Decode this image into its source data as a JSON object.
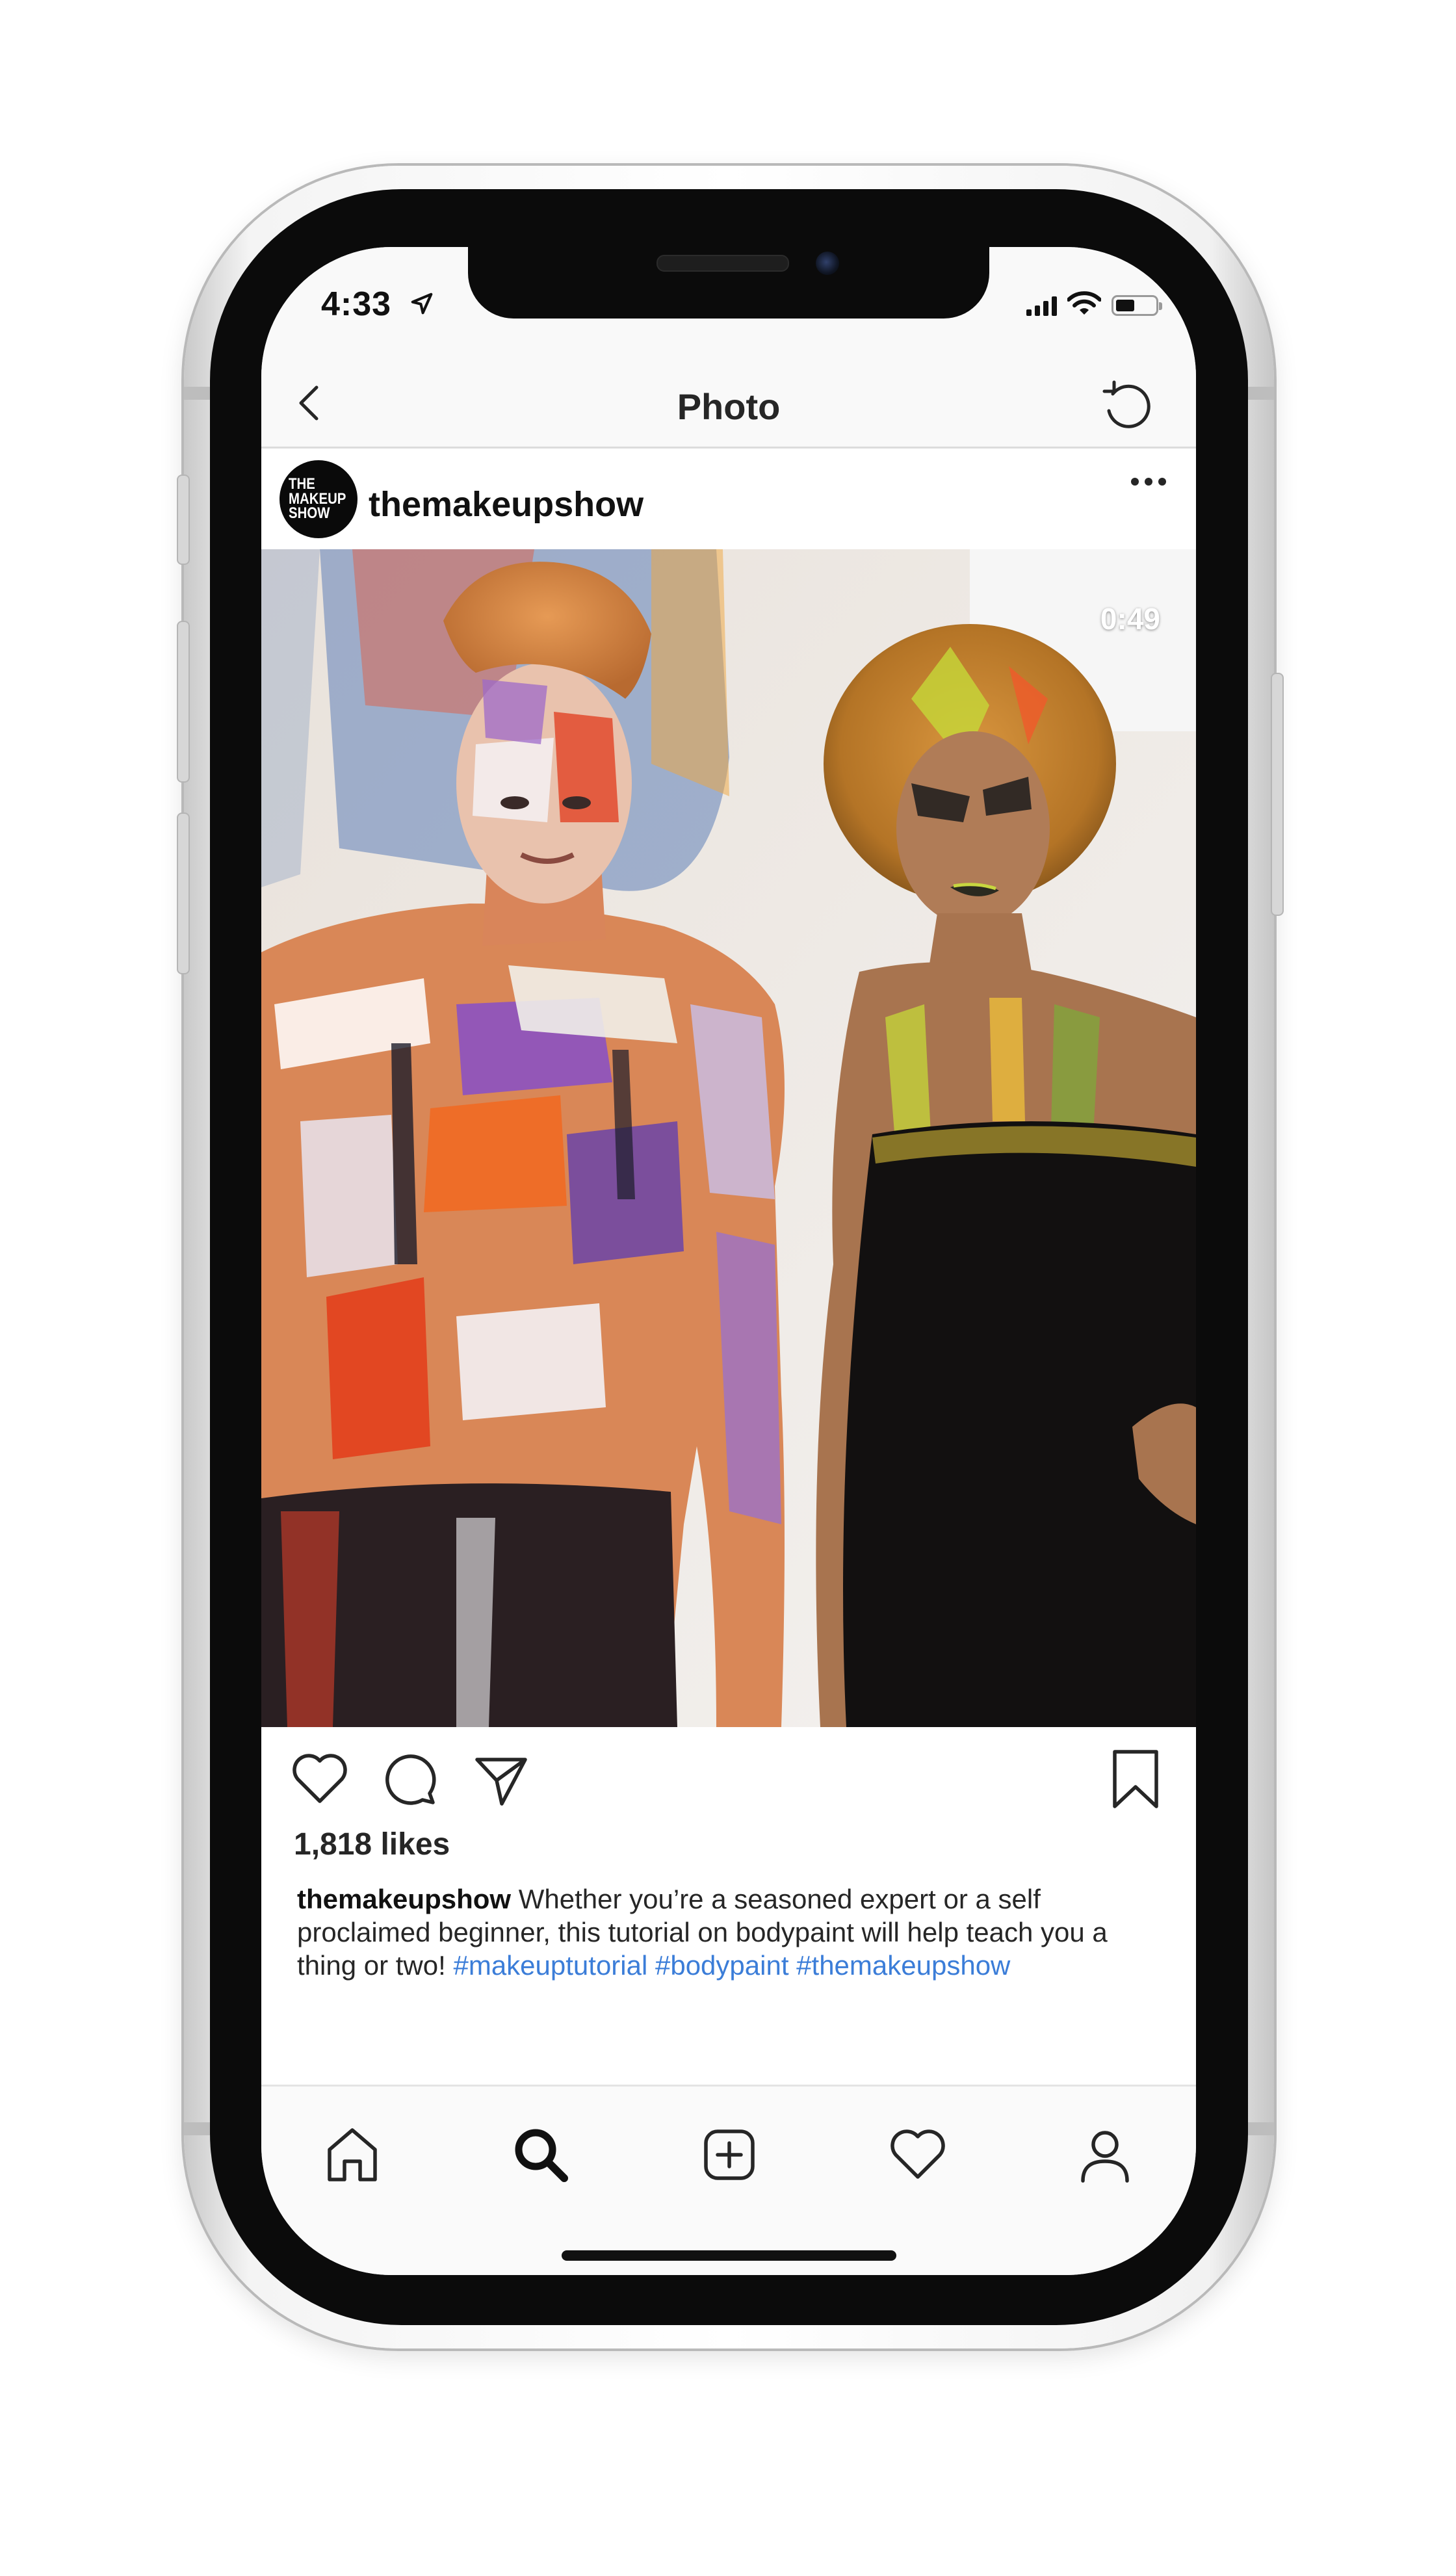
{
  "status_bar": {
    "time": "4:33",
    "icons": [
      "location-arrow-icon",
      "cellular-signal-icon",
      "wifi-icon",
      "battery-icon"
    ]
  },
  "nav": {
    "title": "Photo",
    "back_icon": "chevron-left-icon",
    "refresh_icon": "refresh-icon"
  },
  "post": {
    "avatar_text": [
      "THE",
      "MAKEUP",
      "SHOW"
    ],
    "username": "themakeupshow",
    "more_icon": "more-horizontal-icon",
    "video_duration": "0:49",
    "likes": "1,818 likes",
    "caption": {
      "username": "themakeupshow",
      "text": "Whether you’re a seasoned expert or a self proclaimed beginner, this tutorial on bodypaint will help teach you a thing or two!",
      "hashtags": [
        "#makeuptutorial",
        "#bodypaint",
        "#themakeupshow"
      ]
    },
    "actions": [
      "heart-icon",
      "comment-icon",
      "share-icon",
      "bookmark-icon"
    ]
  },
  "tab_bar": {
    "items": [
      "home-icon",
      "search-icon",
      "new-post-icon",
      "activity-heart-icon",
      "profile-icon"
    ]
  },
  "colors": {
    "hashtag": "#3b7dd8",
    "text": "#262626",
    "bar_background": "#f9f9f9"
  }
}
